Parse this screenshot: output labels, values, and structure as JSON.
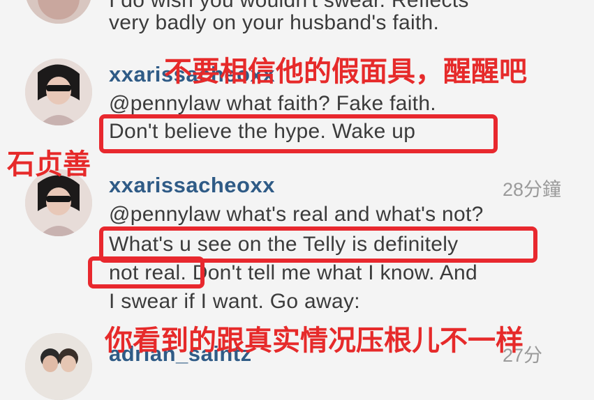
{
  "comments": [
    {
      "lines": [
        "I do wish you wouldn't swear. Reflects",
        "very badly on your husband's faith."
      ]
    },
    {
      "username": "xxarissacheoxx",
      "lines": [
        "@pennylaw what faith? Fake faith.",
        "Don't believe the hype. Wake up"
      ]
    },
    {
      "username": "xxarissacheoxx",
      "time": "28分鐘",
      "lines": [
        "@pennylaw what's real and what's not?",
        "What's u see on the Telly is definitely",
        "not real. Don't tell me what I know. And",
        "I swear if I want. Go away:"
      ]
    },
    {
      "username": "adrian_saintz",
      "time": "27分"
    }
  ],
  "annotations": {
    "top": "不要相信他的假面具，醒醒吧",
    "left": "石贞善",
    "bottom": "你看到的跟真实情况压根儿不一样"
  },
  "colors": {
    "username": "#2f5b86",
    "annotation": "#e62a2a",
    "box": "#e8282e"
  }
}
